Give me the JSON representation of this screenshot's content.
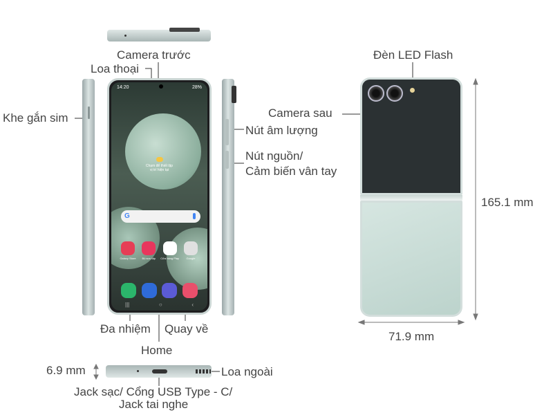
{
  "labels": {
    "camera_front": "Camera trước",
    "earpiece": "Loa thoại",
    "sim_slot": "Khe gắn sim",
    "volume": "Nút âm lượng",
    "power_line1": "Nút nguồn/",
    "power_line2": "Cảm biến vân tay",
    "recent": "Đa nhiệm",
    "back": "Quay về",
    "home": "Home",
    "thickness": "6.9 mm",
    "speaker": "Loa ngoài",
    "usb_line1": "Jack sạc/ Cổng USB Type - C/",
    "usb_line2": "Jack tai nghe",
    "flash": "Đèn LED Flash",
    "camera_rear": "Camera sau",
    "height": "165.1 mm",
    "width": "71.9 mm"
  },
  "screen": {
    "time": "14:20",
    "battery": "28%",
    "weather_line1": "Chạm để thiết lập",
    "weather_line2": "vị trí hiện tại",
    "apps": [
      "Galaxy Store",
      "Bộ sưu tập",
      "Cửa hàng Play",
      "Google"
    ],
    "app_colors": [
      "#e63e56",
      "#e8365d",
      "#ffffff",
      "#e0e0e0"
    ],
    "dock_colors": [
      "#2bb56b",
      "#2f6bd8",
      "#5b5bd6",
      "#e94f6b"
    ]
  },
  "icons": [
    "phone-icon",
    "messages-icon",
    "internet-icon",
    "camera-app-icon",
    "google-g-icon",
    "mic-icon"
  ]
}
